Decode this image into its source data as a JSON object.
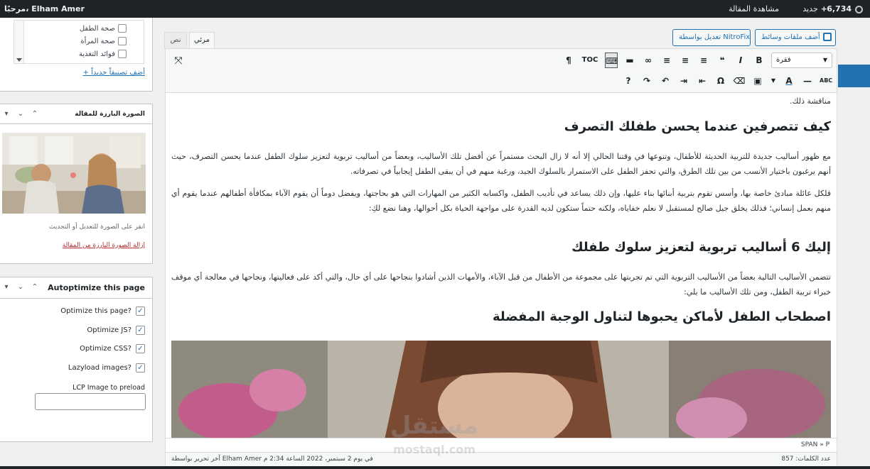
{
  "adminbar": {
    "greeting": "مرحبًا، Elham Amer",
    "view_post": "مشاهدة المقالة",
    "new": "جديد",
    "count": "6,734"
  },
  "categories": {
    "items": [
      "صحة الطفل",
      "صحة المرأة",
      "فوائد التغذية"
    ],
    "add_link": "+ أضف تصنيفاً جديداً"
  },
  "featured": {
    "title": "الصورة البارزة للمقالة",
    "hint": "انقر على الصورة للتعديل أو التحديث",
    "remove": "إزالة الصورة البارزة من المقالة"
  },
  "autoptimize": {
    "title": "Autoptimize this page",
    "options": [
      "Optimize this page?",
      "Optimize JS?",
      "Optimize CSS?",
      "Lazyload images?"
    ],
    "lcp_label": "LCP Image to preload",
    "lcp_value": ""
  },
  "editor": {
    "add_media": "أضف ملفات وسائط",
    "nitro": "تعديل بواسطة NitroFix",
    "tab_visual": "مرئي",
    "tab_text": "نص",
    "format": "فقرة",
    "toc": "TOC",
    "intro": "مناقشة ذلك.",
    "h1": "كيف تتصرفين عندما يحسن طفلك التصرف",
    "p1": "مع ظهور أساليب جديدة للتربية الحديثة للأطفال، وتنوعها في وقتنا الحالي إلا أنه لا زال البحث مستمراً عن أفضل تلك الأساليب، وبعضاً من أساليب تربوية لتعزيز سلوك الطفل عندما يحسن التصرف، حيث أنهم يرغبون باختيار الأنسب من بين تلك الطرق، والتي تحفز الطفل على الاستمرار بالسلوك الجيد، ورغبة منهم في أن يبقى الطفل إيجابياً في تصرفاته.",
    "p2": "فلكل عائلة مبادئ خاصة بها، وأسس تقوم بتربية أبنائها بناء عليها، وإن ذلك يساعد في تأديب الطفل، واكسابه الكثير من المهارات التي هو بحاجتها، ويفضل دوماً أن يقوم الآباء بمكافأة أطفالهم عندما يقوم أي منهم بعمل إنساني؛ فذلك يخلق جيل صالح لمستقبل لا نعلم خفاياه، ولكنه حتماً ستكون لديه القدرة على مواجهة الحياة بكل أحوالها، وهنا نضع لكِ:",
    "h2": "إليك 6 أساليب تربوية لتعزيز سلوك طفلك",
    "p3": "تتضمن الأساليب التالية بعضاً من الأساليب التربوية التي تم تجربتها على مجموعة من الأطفال من قبل الآباء، والأمهات الذين أشادوا بنجاحها على أي حال، والتي أكد على فعاليتها، ونجاحها في معالجة أي موقف خبراء تربية الطفل، ومن تلك الأساليب ما يلي:",
    "h3": "اصطحاب الطفل لأماكن يحبوها لتناول الوجبة المفضلة",
    "path": "SPAN » P",
    "word_count": "عدد الكلمات: 857",
    "last_edit": "آخر تحرير بواسطة Elham Amer في يوم 2 سبتمبر، 2022 الساعة 2:34 م"
  },
  "watermark": {
    "text_ar": "مستقل",
    "text_en": "mostaql.com"
  }
}
